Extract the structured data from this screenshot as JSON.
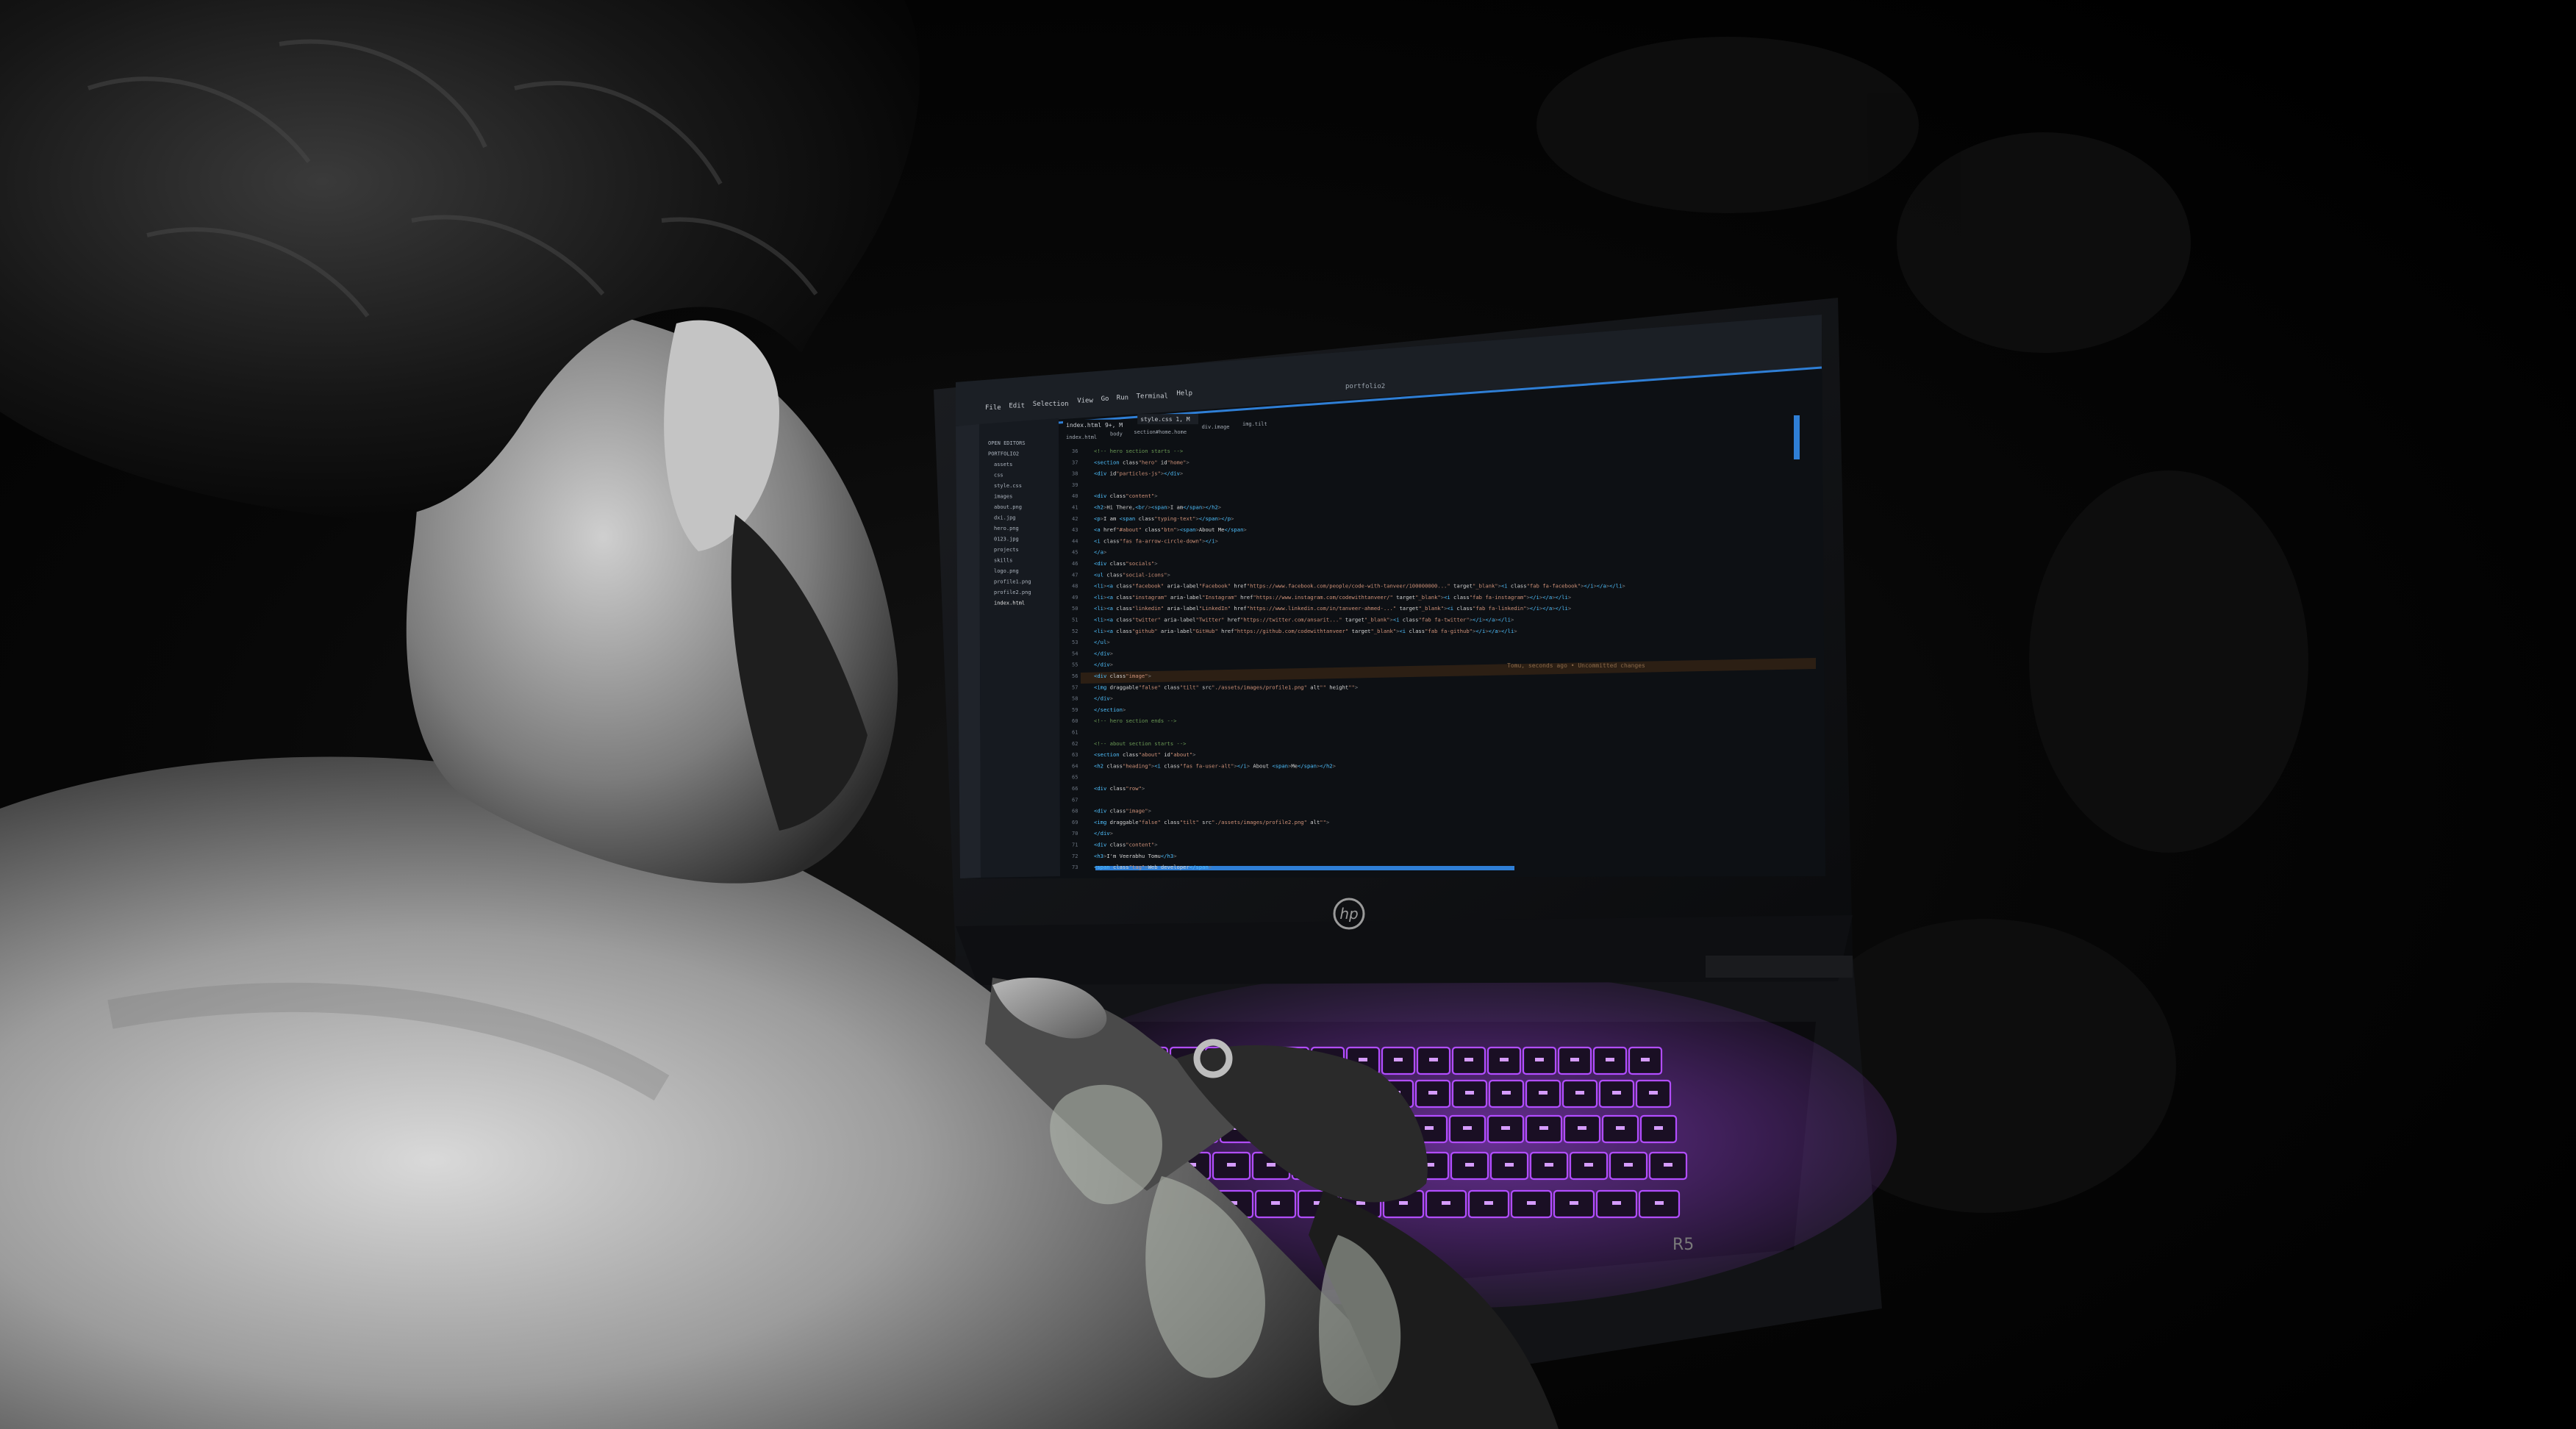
{
  "laptop": {
    "brand_logo": "hp",
    "model_label": "R5"
  },
  "editor": {
    "title": "portfolio2",
    "menu_items": [
      "File",
      "Edit",
      "Selection",
      "View",
      "Go",
      "Run",
      "Terminal",
      "Help"
    ],
    "tabs": [
      "index.html 9+, M",
      "style.css 1, M"
    ],
    "breadcrumb": [
      "index.html",
      "body",
      "section#home.home",
      "div.image",
      "img.tilt"
    ],
    "explorer_items": [
      "OPEN EDITORS",
      "PORTFOLIO2",
      "assets",
      "css",
      "style.css",
      "images",
      "about.png",
      "dxi.jpg",
      "hero.png",
      "0123.jpg",
      "projects",
      "skills",
      "logo.png",
      "profile1.png",
      "profile2.png",
      "index.html"
    ],
    "line_numbers": [
      "36",
      "37",
      "38",
      "39",
      "40",
      "41",
      "42",
      "43",
      "44",
      "45",
      "46",
      "47",
      "48",
      "49",
      "50",
      "51",
      "52",
      "53",
      "54",
      "55",
      "56",
      "57",
      "58",
      "59",
      "60",
      "61",
      "62",
      "63",
      "64",
      "65",
      "66",
      "67",
      "68",
      "69",
      "70",
      "71",
      "72",
      "73"
    ],
    "code_lines": [
      "<!-- hero section starts -->",
      "<section class=\"hero\" id=\"home\">",
      "  <div id=\"particles-js\"></div>",
      "",
      "  <div class=\"content\">",
      "    <h2>Hi There,<br/><span>I am</span></h2>",
      "    <p>I am <span class=\"typing-text\"></span></p>",
      "    <a href=\"#about\" class=\"btn\"><span>About Me</span>",
      "      <i class=\"fas fa-arrow-circle-down\"></i>",
      "    </a>",
      "    <div class=\"socials\">",
      "      <ul class=\"social-icons\">",
      "        <li><a class=\"facebook\" aria-label=\"Facebook\" href=\"https://www.facebook.com/people/code-with-tanveer/100000000...\" target=\"_blank\"><i class=\"fab fa-facebook\"></i></a></li>",
      "        <li><a class=\"instagram\" aria-label=\"Instagram\" href=\"https://www.instagram.com/codewithtanveer/\" target=\"_blank\"><i class=\"fab fa-instagram\"></i></a></li>",
      "        <li><a class=\"linkedin\" aria-label=\"LinkedIn\" href=\"https://www.linkedin.com/in/tanveer-ahmed-...\" target=\"_blank\"><i class=\"fab fa-linkedin\"></i></a></li>",
      "        <li><a class=\"twitter\" aria-label=\"Twitter\" href=\"https://twitter.com/ansarit...\" target=\"_blank\"><i class=\"fab fa-twitter\"></i></a></li>",
      "        <li><a class=\"github\" aria-label=\"GitHub\" href=\"https://github.com/codewithtanveer\" target=\"_blank\"><i class=\"fab fa-github\"></i></a></li>",
      "      </ul>",
      "    </div>",
      "  </div>",
      "  <div class=\"image\">",
      "    <img draggable=\"false\" class=\"tilt\" src=\"./assets/images/profile1.png\" alt=\"\" height=\"\">",
      "  </div>",
      "</section>",
      "<!-- hero section ends -->",
      "",
      "<!-- about section starts -->",
      "<section class=\"about\" id=\"about\">",
      "  <h2 class=\"heading\"><i class=\"fas fa-user-alt\"></i> About <span>Me</span></h2>",
      "",
      "  <div class=\"row\">",
      "",
      "    <div class=\"image\">",
      "      <img draggable=\"false\" class=\"tilt\" src=\"./assets/images/profile2.png\" alt=\"\">",
      "    </div>",
      "    <div class=\"content\">",
      "      <h3>I'm Veerabhu Tomu</h3>",
      "      <span class=\"tag\">Web developer</span>"
    ],
    "status_text": "Tomu, seconds ago • Uncommitted changes"
  },
  "colors": {
    "background": "#000000",
    "screen_bg": "#0d1014",
    "sidebar_bg": "#161a20",
    "accent_blue": "#2f7fd6",
    "keyboard_glow": "#b24dff",
    "tag_color": "#4fc1ff",
    "attr_color": "#9cdcfe",
    "string_color": "#ce9178",
    "text_color": "#d4d4d4"
  }
}
